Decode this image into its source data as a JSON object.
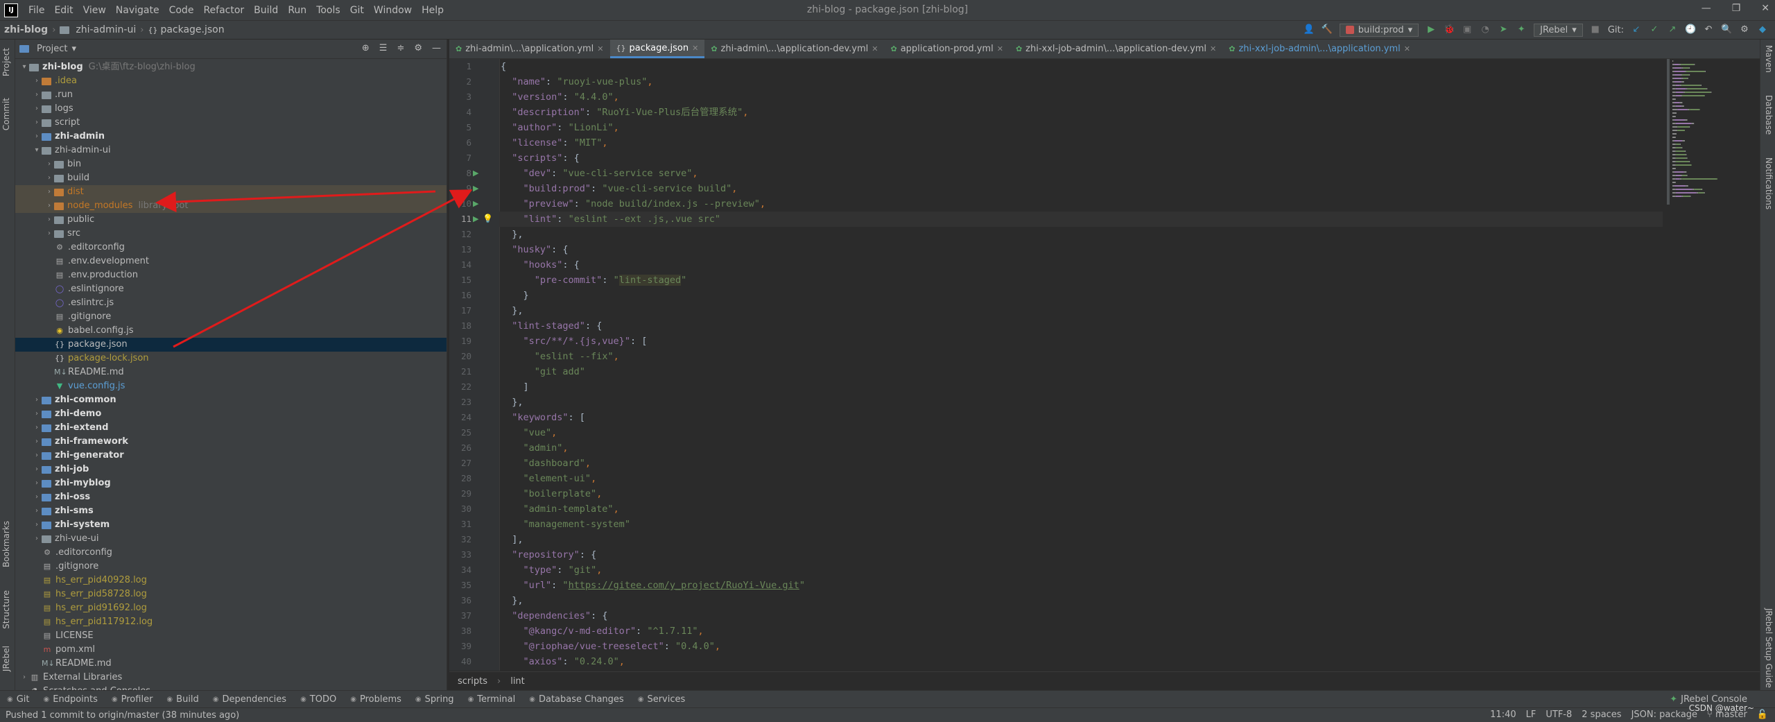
{
  "app": {
    "logo_text": "IJ",
    "window_title": "zhi-blog - package.json [zhi-blog]",
    "menu": [
      "File",
      "Edit",
      "View",
      "Navigate",
      "Code",
      "Refactor",
      "Build",
      "Run",
      "Tools",
      "Git",
      "Window",
      "Help"
    ],
    "window_controls": [
      "minimize-icon",
      "restore-icon",
      "close-icon"
    ]
  },
  "navbar": {
    "crumbs": [
      "zhi-blog",
      "zhi-admin-ui",
      "package.json"
    ],
    "run_config": "build:prod",
    "jrebel": "JRebel",
    "git_label": "Git:"
  },
  "left_stripe": {
    "tabs": [
      "Project",
      "Commit",
      "Bookmarks",
      "Structure",
      "JRebel"
    ]
  },
  "right_stripe": {
    "tabs": [
      "Maven",
      "Database",
      "Notifications",
      "JRebel Setup Guide"
    ]
  },
  "project": {
    "title": "Project",
    "tree": [
      {
        "depth": 0,
        "arrow": "v",
        "icon": "folder",
        "label": "zhi-blog",
        "hint": "G:\\桌面\\ftz-blog\\zhi-blog",
        "style": "mod"
      },
      {
        "depth": 1,
        "arrow": ">",
        "icon": "folder-orange",
        "label": ".idea",
        "style": "t-yellow"
      },
      {
        "depth": 1,
        "arrow": ">",
        "icon": "folder",
        "label": ".run",
        "style": ""
      },
      {
        "depth": 1,
        "arrow": ">",
        "icon": "folder",
        "label": "logs",
        "style": ""
      },
      {
        "depth": 1,
        "arrow": ">",
        "icon": "folder",
        "label": "script",
        "style": ""
      },
      {
        "depth": 1,
        "arrow": ">",
        "icon": "folder-blue",
        "label": "zhi-admin",
        "style": "mod"
      },
      {
        "depth": 1,
        "arrow": "v",
        "icon": "folder",
        "label": "zhi-admin-ui",
        "style": ""
      },
      {
        "depth": 2,
        "arrow": ">",
        "icon": "folder",
        "label": "bin",
        "style": ""
      },
      {
        "depth": 2,
        "arrow": ">",
        "icon": "folder",
        "label": "build",
        "style": ""
      },
      {
        "depth": 2,
        "arrow": ">",
        "icon": "folder-orange",
        "label": "dist",
        "style": "t-orange",
        "row": "excluded-bg"
      },
      {
        "depth": 2,
        "arrow": ">",
        "icon": "folder-orange",
        "label": "node_modules",
        "hint": "library root",
        "style": "t-orange",
        "row": "excluded-bg"
      },
      {
        "depth": 2,
        "arrow": ">",
        "icon": "folder",
        "label": "public",
        "style": ""
      },
      {
        "depth": 2,
        "arrow": ">",
        "icon": "folder",
        "label": "src",
        "style": ""
      },
      {
        "depth": 2,
        "arrow": "",
        "icon": "gear",
        "label": ".editorconfig",
        "style": ""
      },
      {
        "depth": 2,
        "arrow": "",
        "icon": "file",
        "label": ".env.development",
        "style": ""
      },
      {
        "depth": 2,
        "arrow": "",
        "icon": "file",
        "label": ".env.production",
        "style": ""
      },
      {
        "depth": 2,
        "arrow": "",
        "icon": "circle",
        "label": ".eslintignore",
        "style": ""
      },
      {
        "depth": 2,
        "arrow": "",
        "icon": "circle",
        "label": ".eslintrc.js",
        "style": ""
      },
      {
        "depth": 2,
        "arrow": "",
        "icon": "file",
        "label": ".gitignore",
        "style": ""
      },
      {
        "depth": 2,
        "arrow": "",
        "icon": "babel",
        "label": "babel.config.js",
        "style": ""
      },
      {
        "depth": 2,
        "arrow": "",
        "icon": "json",
        "label": "package.json",
        "style": "",
        "row": "selected"
      },
      {
        "depth": 2,
        "arrow": "",
        "icon": "json",
        "label": "package-lock.json",
        "style": "t-yellow"
      },
      {
        "depth": 2,
        "arrow": "",
        "icon": "md",
        "label": "README.md",
        "style": ""
      },
      {
        "depth": 2,
        "arrow": "",
        "icon": "vue",
        "label": "vue.config.js",
        "style": "t-blue"
      },
      {
        "depth": 1,
        "arrow": ">",
        "icon": "folder-blue",
        "label": "zhi-common",
        "style": "mod"
      },
      {
        "depth": 1,
        "arrow": ">",
        "icon": "folder-blue",
        "label": "zhi-demo",
        "style": "mod"
      },
      {
        "depth": 1,
        "arrow": ">",
        "icon": "folder-blue",
        "label": "zhi-extend",
        "style": "mod"
      },
      {
        "depth": 1,
        "arrow": ">",
        "icon": "folder-blue",
        "label": "zhi-framework",
        "style": "mod"
      },
      {
        "depth": 1,
        "arrow": ">",
        "icon": "folder-blue",
        "label": "zhi-generator",
        "style": "mod"
      },
      {
        "depth": 1,
        "arrow": ">",
        "icon": "folder-blue",
        "label": "zhi-job",
        "style": "mod"
      },
      {
        "depth": 1,
        "arrow": ">",
        "icon": "folder-blue",
        "label": "zhi-myblog",
        "style": "mod"
      },
      {
        "depth": 1,
        "arrow": ">",
        "icon": "folder-blue",
        "label": "zhi-oss",
        "style": "mod"
      },
      {
        "depth": 1,
        "arrow": ">",
        "icon": "folder-blue",
        "label": "zhi-sms",
        "style": "mod"
      },
      {
        "depth": 1,
        "arrow": ">",
        "icon": "folder-blue",
        "label": "zhi-system",
        "style": "mod"
      },
      {
        "depth": 1,
        "arrow": ">",
        "icon": "folder",
        "label": "zhi-vue-ui",
        "style": ""
      },
      {
        "depth": 1,
        "arrow": "",
        "icon": "gear",
        "label": ".editorconfig",
        "style": ""
      },
      {
        "depth": 1,
        "arrow": "",
        "icon": "file",
        "label": ".gitignore",
        "style": ""
      },
      {
        "depth": 1,
        "arrow": "",
        "icon": "log",
        "label": "hs_err_pid40928.log",
        "style": "t-yellow"
      },
      {
        "depth": 1,
        "arrow": "",
        "icon": "log",
        "label": "hs_err_pid58728.log",
        "style": "t-yellow"
      },
      {
        "depth": 1,
        "arrow": "",
        "icon": "log",
        "label": "hs_err_pid91692.log",
        "style": "t-yellow"
      },
      {
        "depth": 1,
        "arrow": "",
        "icon": "log",
        "label": "hs_err_pid117912.log",
        "style": "t-yellow"
      },
      {
        "depth": 1,
        "arrow": "",
        "icon": "file",
        "label": "LICENSE",
        "style": ""
      },
      {
        "depth": 1,
        "arrow": "",
        "icon": "maven",
        "label": "pom.xml",
        "style": ""
      },
      {
        "depth": 1,
        "arrow": "",
        "icon": "md",
        "label": "README.md",
        "style": ""
      },
      {
        "depth": 0,
        "arrow": ">",
        "icon": "lib",
        "label": "External Libraries",
        "style": ""
      },
      {
        "depth": 0,
        "arrow": "",
        "icon": "scratch",
        "label": "Scratches and Consoles",
        "style": ""
      }
    ]
  },
  "editor": {
    "tabs": [
      {
        "label": "zhi-admin\\...\\application.yml",
        "type": "yml",
        "active": false
      },
      {
        "label": "package.json",
        "type": "json",
        "active": true
      },
      {
        "label": "zhi-admin\\...\\application-dev.yml",
        "type": "yml",
        "active": false
      },
      {
        "label": "application-prod.yml",
        "type": "yml",
        "active": false
      },
      {
        "label": "zhi-xxl-job-admin\\...\\application-dev.yml",
        "type": "yml",
        "active": false
      },
      {
        "label": "zhi-xxl-job-admin\\...\\application.yml",
        "type": "yml",
        "active": false,
        "blue": true
      }
    ],
    "current_line": 11,
    "run_lines": [
      8,
      9,
      10,
      11
    ],
    "lines": [
      [
        [
          "b",
          "{"
        ]
      ],
      [
        [
          "b",
          "  "
        ],
        [
          "k",
          "\"name\""
        ],
        [
          "b",
          ": "
        ],
        [
          "s",
          "\"ruoyi-vue-plus\""
        ],
        [
          "p",
          ","
        ]
      ],
      [
        [
          "b",
          "  "
        ],
        [
          "k",
          "\"version\""
        ],
        [
          "b",
          ": "
        ],
        [
          "s",
          "\"4.4.0\""
        ],
        [
          "p",
          ","
        ]
      ],
      [
        [
          "b",
          "  "
        ],
        [
          "k",
          "\"description\""
        ],
        [
          "b",
          ": "
        ],
        [
          "s",
          "\"RuoYi-Vue-Plus后台管理系统\""
        ],
        [
          "p",
          ","
        ]
      ],
      [
        [
          "b",
          "  "
        ],
        [
          "k",
          "\"author\""
        ],
        [
          "b",
          ": "
        ],
        [
          "s",
          "\"LionLi\""
        ],
        [
          "p",
          ","
        ]
      ],
      [
        [
          "b",
          "  "
        ],
        [
          "k",
          "\"license\""
        ],
        [
          "b",
          ": "
        ],
        [
          "s",
          "\"MIT\""
        ],
        [
          "p",
          ","
        ]
      ],
      [
        [
          "b",
          "  "
        ],
        [
          "k",
          "\"scripts\""
        ],
        [
          "b",
          ": {"
        ]
      ],
      [
        [
          "b",
          "    "
        ],
        [
          "k",
          "\"dev\""
        ],
        [
          "b",
          ": "
        ],
        [
          "s",
          "\"vue-cli-service serve\""
        ],
        [
          "p",
          ","
        ]
      ],
      [
        [
          "b",
          "    "
        ],
        [
          "k",
          "\"build:prod\""
        ],
        [
          "b",
          ": "
        ],
        [
          "s",
          "\"vue-cli-service build\""
        ],
        [
          "p",
          ","
        ]
      ],
      [
        [
          "b",
          "    "
        ],
        [
          "k",
          "\"preview\""
        ],
        [
          "b",
          ": "
        ],
        [
          "s",
          "\"node build/index.js --preview\""
        ],
        [
          "p",
          ","
        ]
      ],
      [
        [
          "b",
          "    "
        ],
        [
          "k",
          "\"lint\""
        ],
        [
          "b",
          ": "
        ],
        [
          "s",
          "\"eslint --ext .js,.vue src\""
        ]
      ],
      [
        [
          "b",
          "  },"
        ]
      ],
      [
        [
          "b",
          "  "
        ],
        [
          "k",
          "\"husky\""
        ],
        [
          "b",
          ": {"
        ]
      ],
      [
        [
          "b",
          "    "
        ],
        [
          "k",
          "\"hooks\""
        ],
        [
          "b",
          ": {"
        ]
      ],
      [
        [
          "b",
          "      "
        ],
        [
          "k",
          "\"pre-commit\""
        ],
        [
          "b",
          ": "
        ],
        [
          "s",
          "\""
        ],
        [
          "hl",
          "lint-staged"
        ],
        [
          "s",
          "\""
        ]
      ],
      [
        [
          "b",
          "    }"
        ]
      ],
      [
        [
          "b",
          "  },"
        ]
      ],
      [
        [
          "b",
          "  "
        ],
        [
          "k",
          "\"lint-staged\""
        ],
        [
          "b",
          ": {"
        ]
      ],
      [
        [
          "b",
          "    "
        ],
        [
          "k",
          "\"src/**/*.{js,vue}\""
        ],
        [
          "b",
          ": ["
        ]
      ],
      [
        [
          "b",
          "      "
        ],
        [
          "s",
          "\"eslint --fix\""
        ],
        [
          "p",
          ","
        ]
      ],
      [
        [
          "b",
          "      "
        ],
        [
          "s",
          "\"git add\""
        ]
      ],
      [
        [
          "b",
          "    ]"
        ]
      ],
      [
        [
          "b",
          "  },"
        ]
      ],
      [
        [
          "b",
          "  "
        ],
        [
          "k",
          "\"keywords\""
        ],
        [
          "b",
          ": ["
        ]
      ],
      [
        [
          "b",
          "    "
        ],
        [
          "s",
          "\"vue\""
        ],
        [
          "p",
          ","
        ]
      ],
      [
        [
          "b",
          "    "
        ],
        [
          "s",
          "\"admin\""
        ],
        [
          "p",
          ","
        ]
      ],
      [
        [
          "b",
          "    "
        ],
        [
          "s",
          "\"dashboard\""
        ],
        [
          "p",
          ","
        ]
      ],
      [
        [
          "b",
          "    "
        ],
        [
          "s",
          "\"element-ui\""
        ],
        [
          "p",
          ","
        ]
      ],
      [
        [
          "b",
          "    "
        ],
        [
          "s",
          "\"boilerplate\""
        ],
        [
          "p",
          ","
        ]
      ],
      [
        [
          "b",
          "    "
        ],
        [
          "s",
          "\"admin-template\""
        ],
        [
          "p",
          ","
        ]
      ],
      [
        [
          "b",
          "    "
        ],
        [
          "s",
          "\"management-system\""
        ]
      ],
      [
        [
          "b",
          "  ],"
        ]
      ],
      [
        [
          "b",
          "  "
        ],
        [
          "k",
          "\"repository\""
        ],
        [
          "b",
          ": {"
        ]
      ],
      [
        [
          "b",
          "    "
        ],
        [
          "k",
          "\"type\""
        ],
        [
          "b",
          ": "
        ],
        [
          "s",
          "\"git\""
        ],
        [
          "p",
          ","
        ]
      ],
      [
        [
          "b",
          "    "
        ],
        [
          "k",
          "\"url\""
        ],
        [
          "b",
          ": "
        ],
        [
          "s",
          "\""
        ],
        [
          "u",
          "https://gitee.com/y_project/RuoYi-Vue.git"
        ],
        [
          "s",
          "\""
        ]
      ],
      [
        [
          "b",
          "  },"
        ]
      ],
      [
        [
          "b",
          "  "
        ],
        [
          "k",
          "\"dependencies\""
        ],
        [
          "b",
          ": {"
        ]
      ],
      [
        [
          "b",
          "    "
        ],
        [
          "k",
          "\"@kangc/v-md-editor\""
        ],
        [
          "b",
          ": "
        ],
        [
          "s",
          "\"^1.7.11\""
        ],
        [
          "p",
          ","
        ]
      ],
      [
        [
          "b",
          "    "
        ],
        [
          "k",
          "\"@riophae/vue-treeselect\""
        ],
        [
          "b",
          ": "
        ],
        [
          "s",
          "\"0.4.0\""
        ],
        [
          "p",
          ","
        ]
      ],
      [
        [
          "b",
          "    "
        ],
        [
          "k",
          "\"axios\""
        ],
        [
          "b",
          ": "
        ],
        [
          "s",
          "\"0.24.0\""
        ],
        [
          "p",
          ","
        ]
      ]
    ],
    "breadcrumb": [
      "scripts",
      "lint"
    ]
  },
  "tool_windows": [
    {
      "icon": "git-icon",
      "label": "Git"
    },
    {
      "icon": "endpoints-icon",
      "label": "Endpoints"
    },
    {
      "icon": "profiler-icon",
      "label": "Profiler"
    },
    {
      "icon": "build-icon",
      "label": "Build"
    },
    {
      "icon": "dependencies-icon",
      "label": "Dependencies"
    },
    {
      "icon": "todo-icon",
      "label": "TODO"
    },
    {
      "icon": "problems-icon",
      "label": "Problems"
    },
    {
      "icon": "spring-icon",
      "label": "Spring"
    },
    {
      "icon": "terminal-icon",
      "label": "Terminal"
    },
    {
      "icon": "database-changes-icon",
      "label": "Database Changes"
    },
    {
      "icon": "services-icon",
      "label": "Services"
    }
  ],
  "tool_windows_right": "JRebel Console",
  "status": {
    "message": "Pushed 1 commit to origin/master (38 minutes ago)",
    "position": "11:40",
    "line_sep": "LF",
    "encoding": "UTF-8",
    "indent": "2 spaces",
    "schema": "JSON: package",
    "branch": "master",
    "watermark": "CSDN @water~"
  },
  "colors": {
    "accent": "#4a88c7",
    "arrow": "#e01b1b",
    "run": "#59a869",
    "key": "#9876aa",
    "string": "#6a8759"
  }
}
